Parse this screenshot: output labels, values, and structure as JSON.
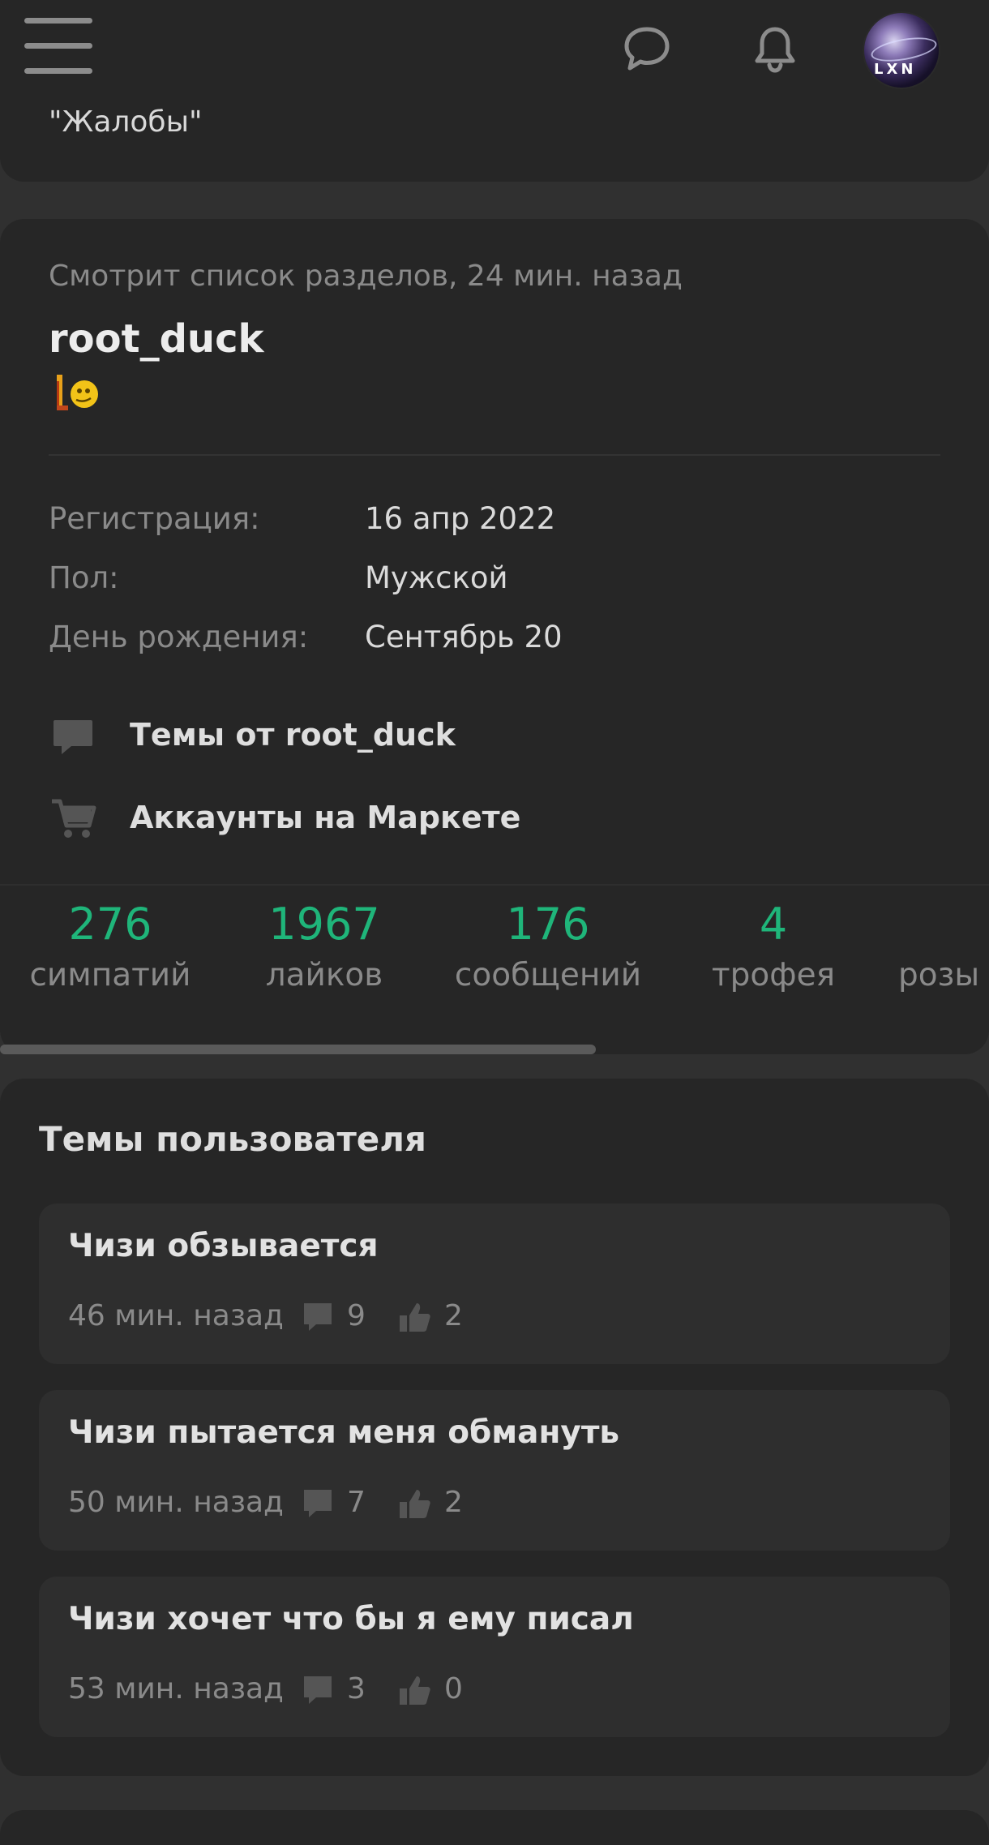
{
  "top_card": {
    "text": "\"Жалобы\""
  },
  "profile": {
    "activity": "Смотрит список разделов, 24 мин. назад",
    "username": "root_duck",
    "info": [
      {
        "label": "Регистрация:",
        "value": "16 апр 2022"
      },
      {
        "label": "Пол:",
        "value": "Мужской"
      },
      {
        "label": "День рождения:",
        "value": "Сентябрь 20"
      }
    ],
    "links": [
      {
        "icon": "speech-bubble-icon",
        "label": "Темы от root_duck"
      },
      {
        "icon": "shopping-cart-icon",
        "label": "Аккаунты на Маркете"
      }
    ],
    "stats": [
      {
        "value": "276",
        "label": "симпатий"
      },
      {
        "value": "1967",
        "label": "лайков"
      },
      {
        "value": "176",
        "label": "сообщений"
      },
      {
        "value": "4",
        "label": "трофея"
      },
      {
        "value": "",
        "label": "розы"
      }
    ]
  },
  "topics": {
    "title": "Темы пользователя",
    "items": [
      {
        "title": "Чизи обзывается",
        "time": "46 мин. назад",
        "comments": "9",
        "likes": "2"
      },
      {
        "title": "Чизи пытается меня обмануть",
        "time": "50 мин. назад",
        "comments": "7",
        "likes": "2"
      },
      {
        "title": "Чизи хочет что бы я ему писал",
        "time": "53 мин. назад",
        "comments": "3",
        "likes": "0"
      }
    ]
  },
  "colors": {
    "accent": "#1fb57a",
    "background": "#303030",
    "card": "#262626",
    "item": "#2e2e2e"
  },
  "avatar": {
    "text": "LXN"
  }
}
